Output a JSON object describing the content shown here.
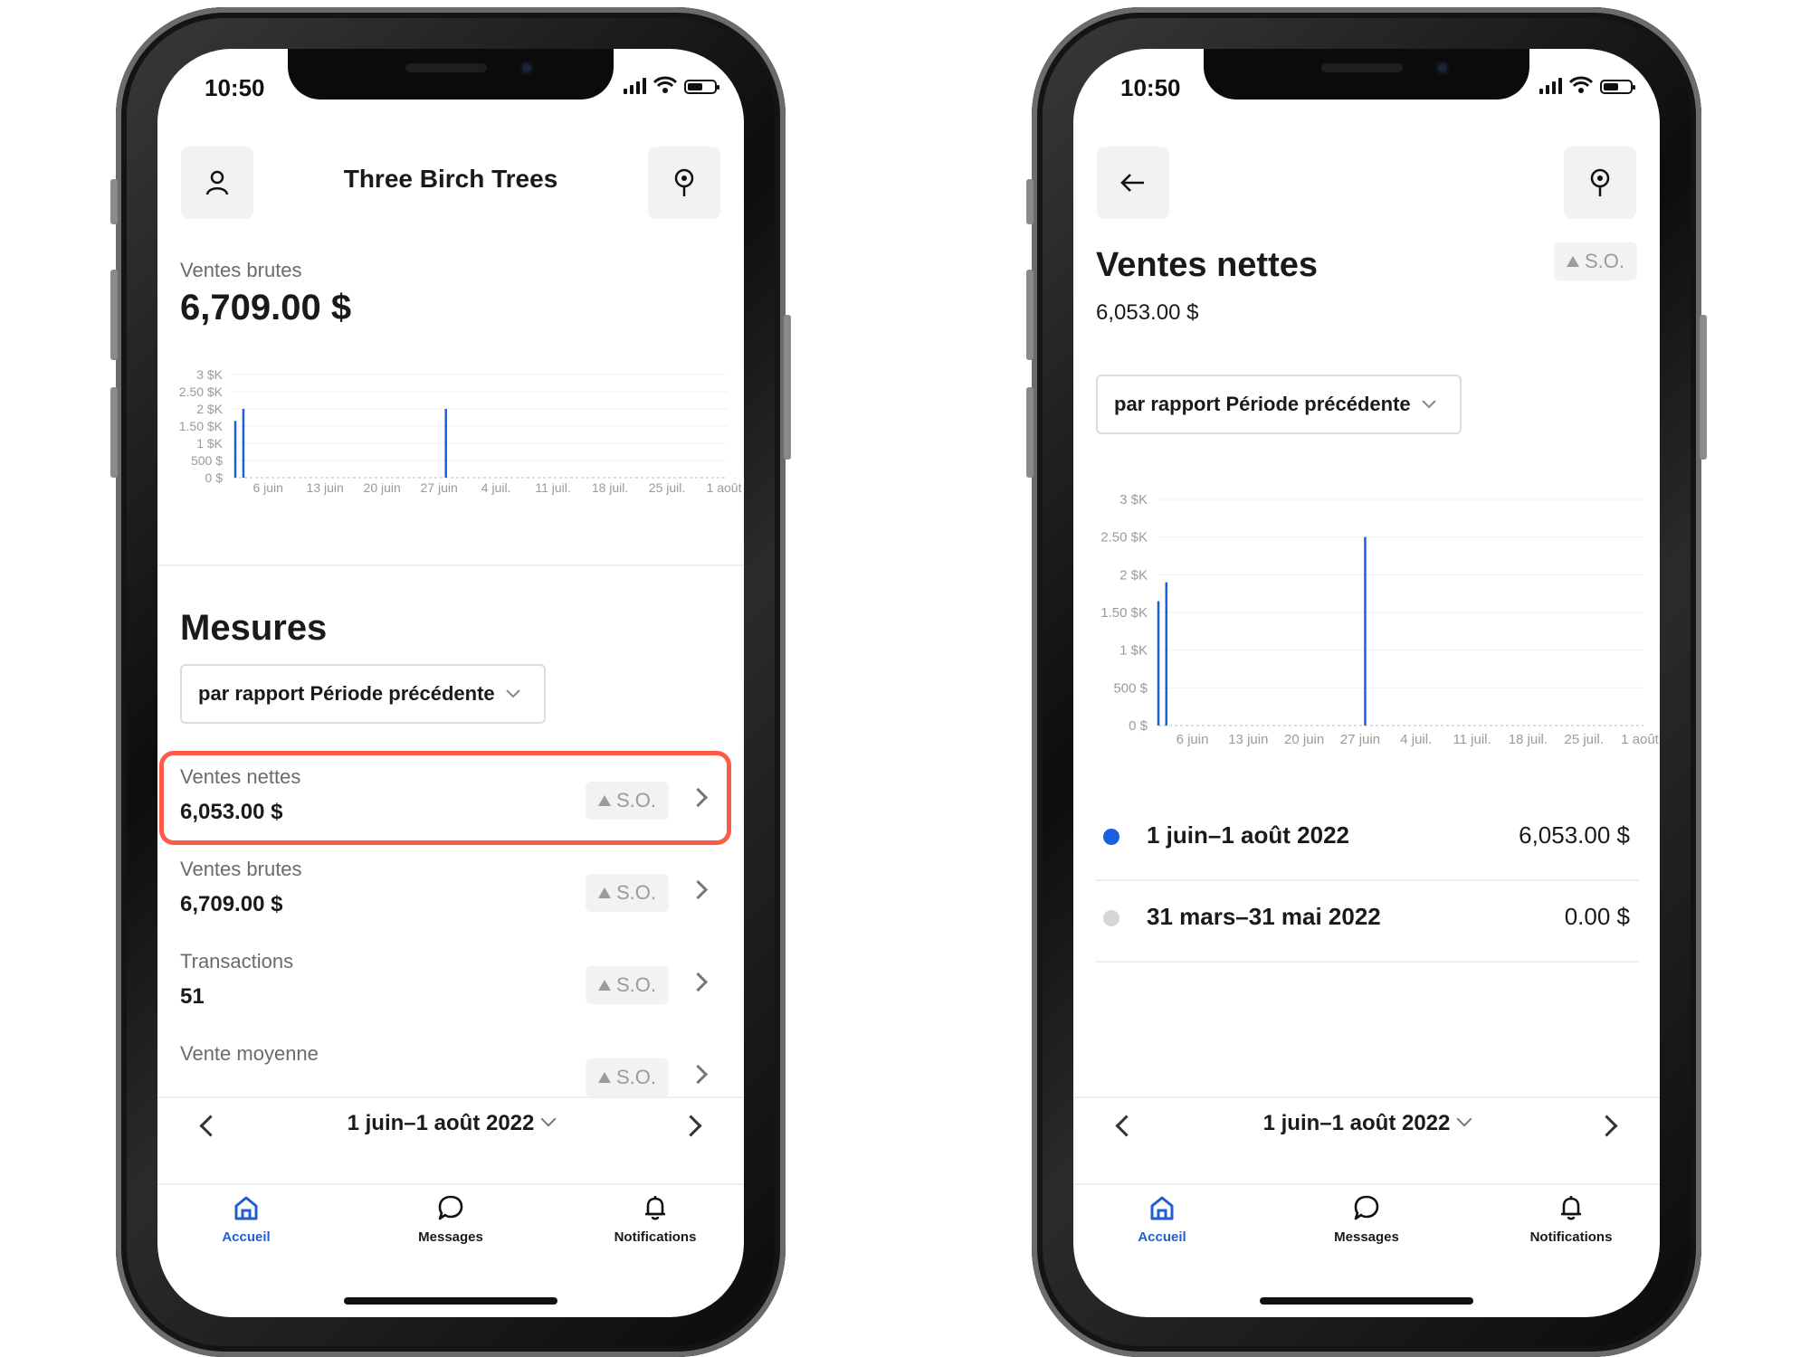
{
  "status_time": "10:50",
  "colors": {
    "accent": "#1f5fd1",
    "bar": "#1a5fe0",
    "highlight": "#ff5a48",
    "muted": "#9b9b9b"
  },
  "left": {
    "header": {
      "title": "Three Birch Trees",
      "profile_icon": "person-icon",
      "location_icon": "location-pin-icon"
    },
    "summary": {
      "label": "Ventes brutes",
      "value": "6,709.00 $"
    },
    "section_title": "Mesures",
    "compare_dropdown": "par rapport Période précédente",
    "metrics": [
      {
        "label": "Ventes nettes",
        "value": "6,053.00 $",
        "badge": "S.O."
      },
      {
        "label": "Ventes brutes",
        "value": "6,709.00 $",
        "badge": "S.O."
      },
      {
        "label": "Transactions",
        "value": "51",
        "badge": "S.O."
      },
      {
        "label": "Vente moyenne",
        "value": "",
        "badge": "S.O."
      }
    ]
  },
  "right": {
    "header": {
      "back_icon": "arrow-left-icon",
      "location_icon": "location-pin-icon"
    },
    "title": "Ventes nettes",
    "value": "6,053.00 $",
    "badge": "S.O.",
    "compare_dropdown": "par rapport Période précédente",
    "legend": [
      {
        "label": "1 juin–1 août 2022",
        "value": "6,053.00 $",
        "color": "#1a5fe0"
      },
      {
        "label": "31 mars–31 mai 2022",
        "value": "0.00 $",
        "color": "#d6d6d6"
      }
    ]
  },
  "date_range": "1 juin–1 août 2022",
  "tabs": [
    {
      "label": "Accueil",
      "icon": "home-icon",
      "active": true
    },
    {
      "label": "Messages",
      "icon": "chat-bubble-icon",
      "active": false
    },
    {
      "label": "Notifications",
      "icon": "bell-icon",
      "active": false
    }
  ],
  "chart_data": [
    {
      "type": "bar",
      "title": "",
      "y_ticks": [
        "3 $K",
        "2.50 $K",
        "2 $K",
        "1.50 $K",
        "1 $K",
        "500 $",
        "0 $"
      ],
      "ylim": [
        0,
        3000
      ],
      "x_ticks": [
        "6 juin",
        "13 juin",
        "20 juin",
        "27 juin",
        "4 juil.",
        "11 juil.",
        "18 juil.",
        "25 juil.",
        "1 août"
      ],
      "x_range": [
        "2022-06-01",
        "2022-08-01"
      ],
      "series": [
        {
          "points": [
            {
              "x": "2022-06-01",
              "y": 1650
            },
            {
              "x": "2022-06-02",
              "y": 2000
            },
            {
              "x": "2022-06-27",
              "y": 2000
            }
          ]
        }
      ]
    },
    {
      "type": "bar",
      "title": "",
      "y_ticks": [
        "3 $K",
        "2.50 $K",
        "2 $K",
        "1.50 $K",
        "1 $K",
        "500 $",
        "0 $"
      ],
      "ylim": [
        0,
        3000
      ],
      "x_ticks": [
        "6 juin",
        "13 juin",
        "20 juin",
        "27 juin",
        "4 juil.",
        "11 juil.",
        "18 juil.",
        "25 juil.",
        "1 août"
      ],
      "x_range": [
        "2022-06-01",
        "2022-08-01"
      ],
      "series": [
        {
          "points": [
            {
              "x": "2022-06-01",
              "y": 1650
            },
            {
              "x": "2022-06-02",
              "y": 1900
            },
            {
              "x": "2022-06-27",
              "y": 2500
            }
          ]
        }
      ]
    }
  ]
}
